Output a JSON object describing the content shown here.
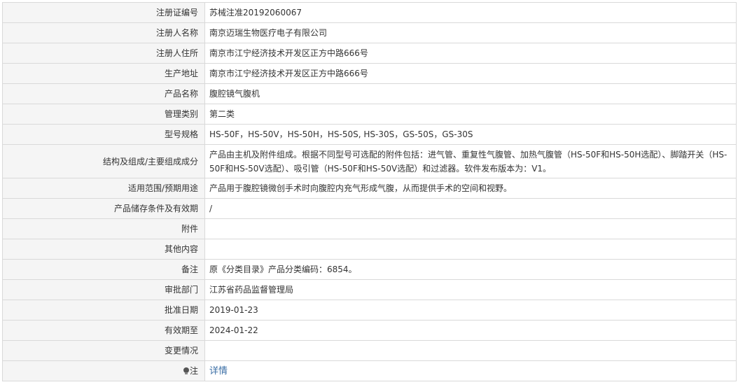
{
  "rows": [
    {
      "label": "注册证编号",
      "value": "苏械注准20192060067"
    },
    {
      "label": "注册人名称",
      "value": "南京迈瑞生物医疗电子有限公司"
    },
    {
      "label": "注册人住所",
      "value": "南京市江宁经济技术开发区正方中路666号"
    },
    {
      "label": "生产地址",
      "value": "南京市江宁经济技术开发区正方中路666号"
    },
    {
      "label": "产品名称",
      "value": "腹腔镜气腹机"
    },
    {
      "label": "管理类别",
      "value": "第二类"
    },
    {
      "label": "型号规格",
      "value": "HS-50F，HS-50V，HS-50H，HS-50S, HS-30S，GS-50S，GS-30S"
    },
    {
      "label": "结构及组成/主要组成成分",
      "value": "产品由主机及附件组成。根据不同型号可选配的附件包括：进气管、重复性气腹管、加热气腹管（HS-50F和HS-50H选配）、脚踏开关（HS-50F和HS-50V选配）、吸引管（HS-50F和HS-50V选配）和过滤器。软件发布版本为：V1。"
    },
    {
      "label": "适用范围/预期用途",
      "value": "产品用于腹腔镜微创手术时向腹腔内充气形成气腹，从而提供手术的空间和视野。"
    },
    {
      "label": "产品储存条件及有效期",
      "value": "/"
    },
    {
      "label": "附件",
      "value": ""
    },
    {
      "label": "其他内容",
      "value": ""
    },
    {
      "label": "备注",
      "value": "原《分类目录》产品分类编码：6854。"
    },
    {
      "label": "审批部门",
      "value": "江苏省药品监督管理局"
    },
    {
      "label": "批准日期",
      "value": "2019-01-23"
    },
    {
      "label": "有效期至",
      "value": "2024-01-22"
    },
    {
      "label": "变更情况",
      "value": ""
    }
  ],
  "note": {
    "label": "注",
    "icon": "lightbulb-icon",
    "link_text": "详情"
  }
}
